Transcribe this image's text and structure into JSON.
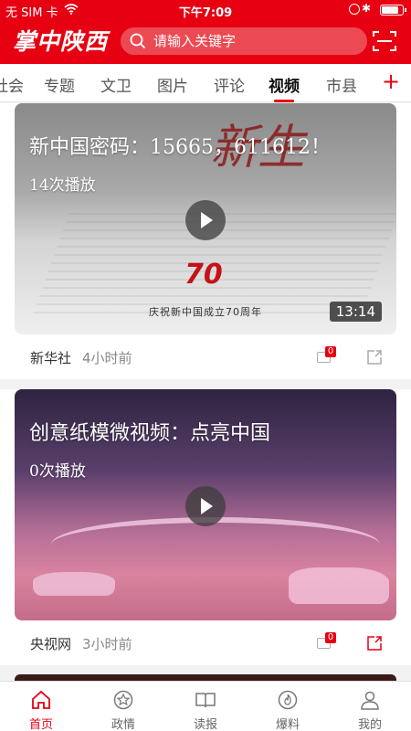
{
  "status": {
    "carrier": "无 SIM 卡",
    "time": "下午7:09",
    "battery_level": 0.85
  },
  "header": {
    "logo": "掌中陕西",
    "search_placeholder": "请输入关键字"
  },
  "tabs": [
    {
      "label": "社会",
      "active": false
    },
    {
      "label": "专题",
      "active": false
    },
    {
      "label": "文卫",
      "active": false
    },
    {
      "label": "图片",
      "active": false
    },
    {
      "label": "评论",
      "active": false
    },
    {
      "label": "视频",
      "active": true
    },
    {
      "label": "市县",
      "active": false
    }
  ],
  "add_label": "+",
  "videos": [
    {
      "title": "新中国密码：15665，611612！",
      "plays": "14次播放",
      "duration": "13:14",
      "caption": "庆祝新中国成立70周年",
      "overlay": "新生",
      "badge": "70",
      "source": "新华社",
      "time_ago": "4小时前",
      "comments": "0"
    },
    {
      "title": "创意纸模微视频：点亮中国",
      "plays": "0次播放",
      "source": "央视网",
      "time_ago": "3小时前",
      "comments": "0"
    }
  ],
  "nav": [
    {
      "label": "首页",
      "icon": "home-icon",
      "active": true
    },
    {
      "label": "政情",
      "icon": "star-badge-icon",
      "active": false
    },
    {
      "label": "读报",
      "icon": "book-icon",
      "active": false
    },
    {
      "label": "爆料",
      "icon": "flame-icon",
      "active": false
    },
    {
      "label": "我的",
      "icon": "user-icon",
      "active": false
    }
  ],
  "colors": {
    "brand": "#e60012",
    "text": "#333333",
    "muted": "#888888"
  }
}
